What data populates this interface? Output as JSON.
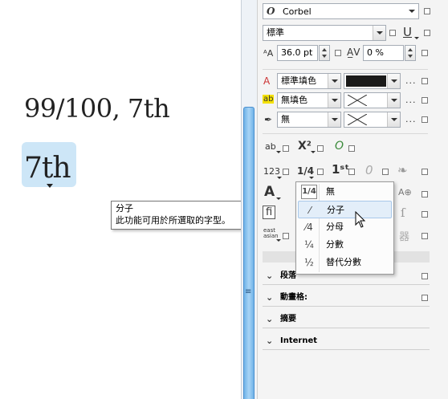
{
  "canvas": {
    "sample_text": "99/100, 7th",
    "selected_glyph": "7th"
  },
  "tooltip": {
    "title": "分子",
    "description": "此功能可用於所選取的字型。"
  },
  "docker": {
    "font_name": "Corbel",
    "font_style": "標準",
    "font_size": "36.0 pt",
    "kerning": "0 %",
    "fill_type": "標準填色",
    "background_fill": "無填色",
    "outline": "無",
    "more_dots": "...",
    "opentype_label_123": "123",
    "opentype_label_east_asian": "east asian",
    "sections": [
      {
        "label": "段落"
      },
      {
        "label": "動畫格:"
      },
      {
        "label": "摘要"
      },
      {
        "label": "Internet"
      }
    ]
  },
  "fraction_menu": {
    "items": [
      {
        "icon": "1/4",
        "label": "無"
      },
      {
        "icon": "⁄",
        "label": "分子"
      },
      {
        "icon": "⁄4",
        "label": "分母"
      },
      {
        "icon": "¼",
        "label": "分數"
      },
      {
        "icon": "½",
        "label": "替代分數"
      }
    ],
    "highlighted_index": 1
  },
  "colors": {
    "selection_bg": "#cde6f7",
    "splitter_blue": "#6fb3e8",
    "menu_highlight": "#e3eef9",
    "fill_swatch": "#1a1a1a"
  }
}
